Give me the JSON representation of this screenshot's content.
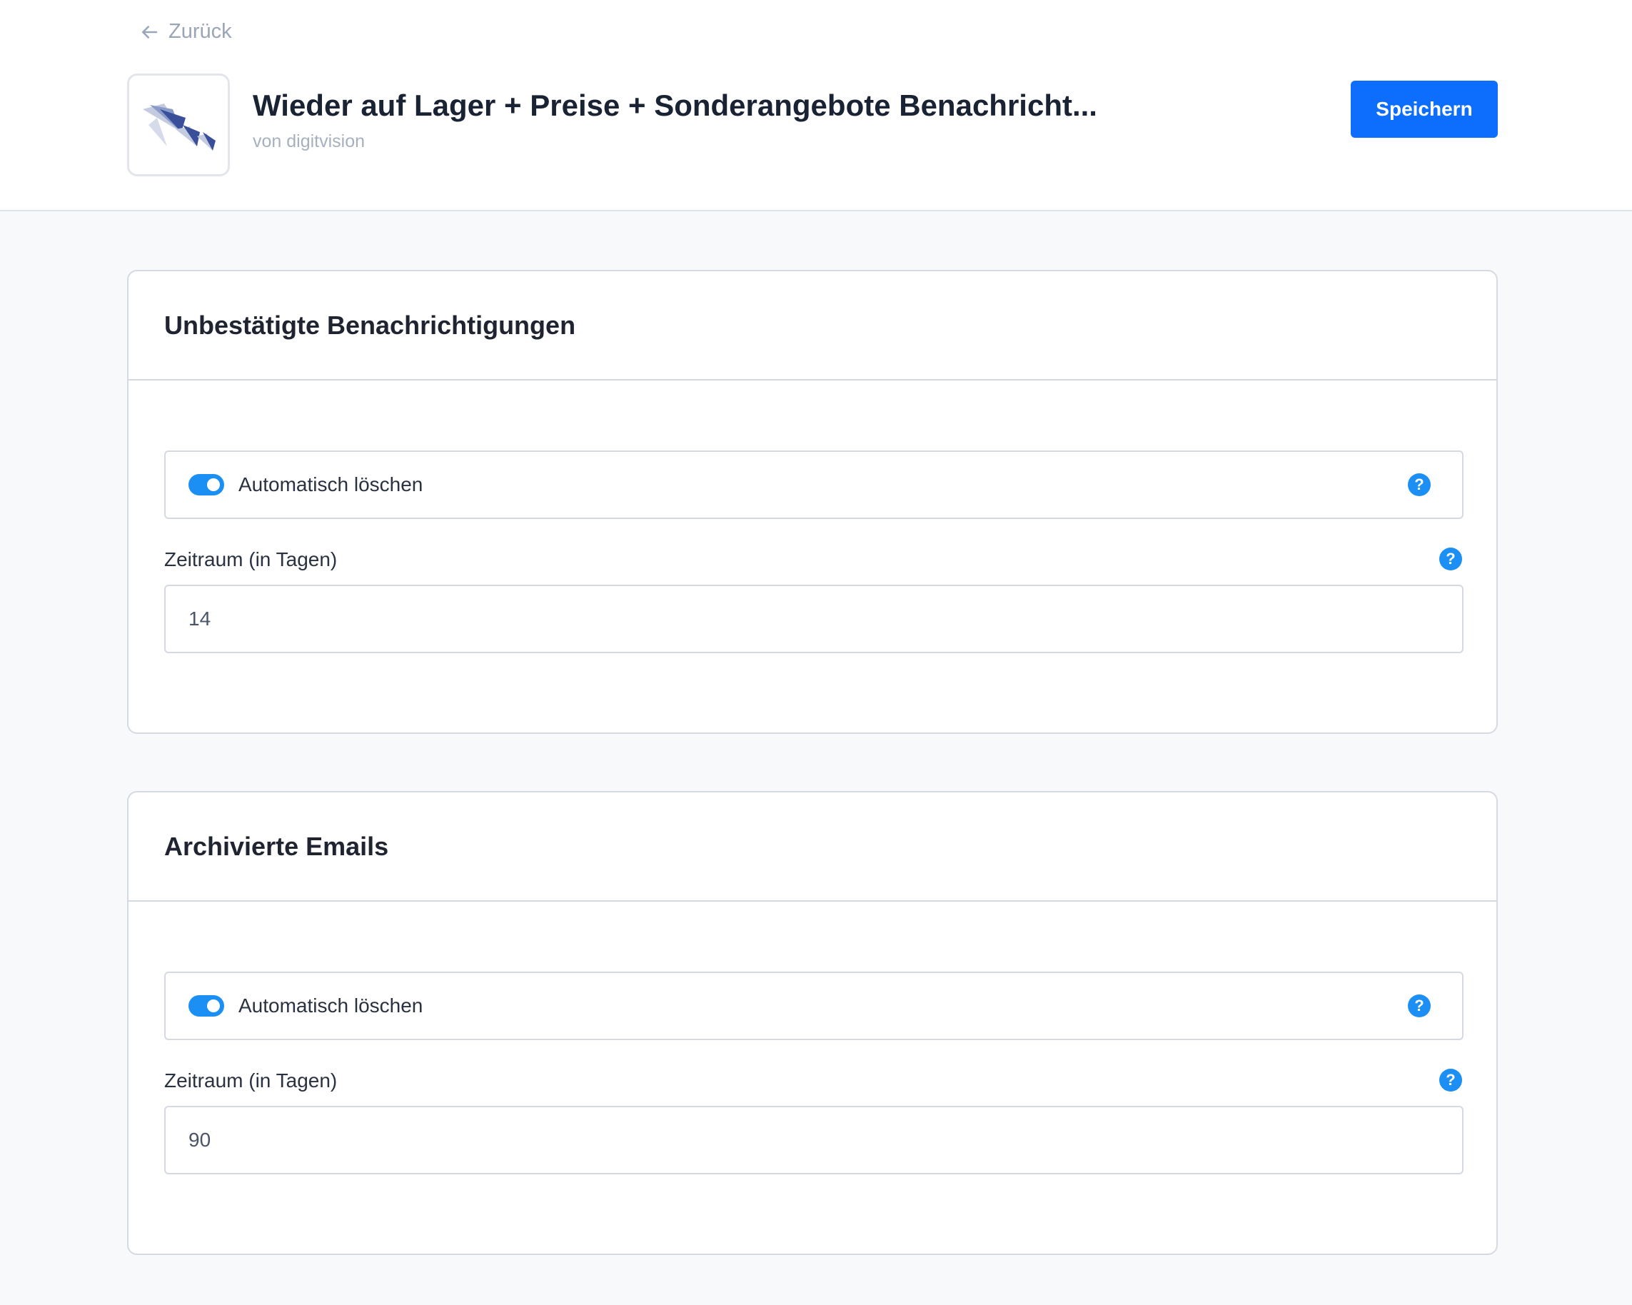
{
  "header": {
    "back_label": "Zurück",
    "app_title": "Wieder auf Lager + Preise + Sonderangebote Benachricht...",
    "app_vendor": "von digitvision",
    "save_label": "Speichern"
  },
  "sections": [
    {
      "title": "Unbestätigte Benachrichtigungen",
      "toggle_label": "Automatisch löschen",
      "toggle_on": true,
      "field_label": "Zeitraum (in Tagen)",
      "field_value": "14",
      "help_glyph": "?"
    },
    {
      "title": "Archivierte Emails",
      "toggle_label": "Automatisch löschen",
      "toggle_on": true,
      "field_label": "Zeitraum (in Tagen)",
      "field_value": "90",
      "help_glyph": "?"
    }
  ],
  "colors": {
    "primary": "#0d6efd",
    "toggle": "#1c8ff5",
    "muted": "#9aa5b8",
    "logo": "#3a4f9a"
  },
  "icons": {
    "back": "arrow-left-icon",
    "app": "app-logo-icon",
    "help": "question-circle-icon"
  }
}
